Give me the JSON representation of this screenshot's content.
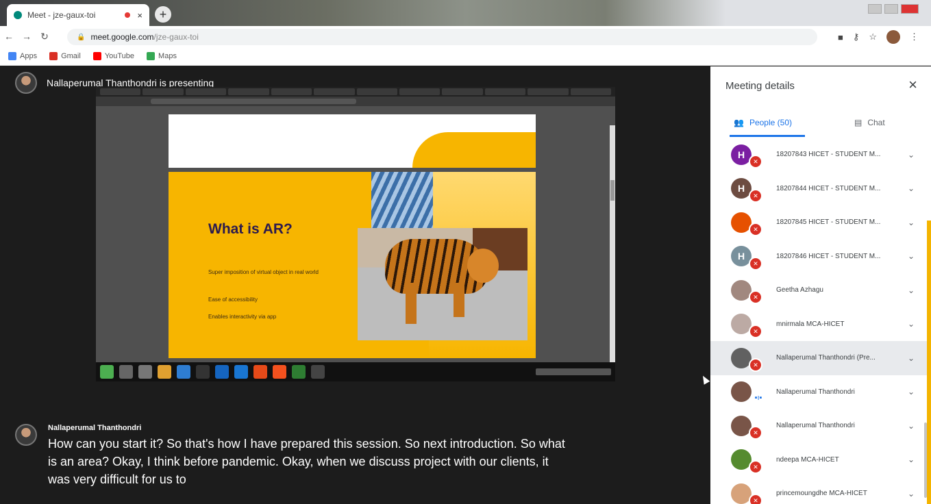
{
  "browser": {
    "tab_title": "Meet - jze-gaux-toi",
    "tab_close": "×",
    "new_tab": "+",
    "url_host": "meet.google.com",
    "url_path": "/jze-gaux-toi",
    "bookmarks": [
      {
        "label": "Apps",
        "color": "#4285f4"
      },
      {
        "label": "Gmail",
        "color": "#d93025"
      },
      {
        "label": "YouTube",
        "color": "#ff0000"
      },
      {
        "label": "Maps",
        "color": "#34a853"
      }
    ]
  },
  "stage": {
    "presenting_text": "Nallaperumal Thanthondri is presenting",
    "slide": {
      "title": "What is AR?",
      "bullets": [
        "Super imposition of virtual object in real world",
        "Ease of accessibility",
        "Enables interactivity via app"
      ]
    },
    "caption": {
      "speaker": "Nallaperumal Thanthondri",
      "text": "How can you start it? So that's how I have prepared this session. So next introduction. So what is an area? Okay, I think before pandemic. Okay, when we discuss project with our clients, it was very difficult for us to"
    }
  },
  "panel": {
    "title": "Meeting details",
    "close": "×",
    "tab_people": "People (50)",
    "tab_chat": "Chat",
    "participants": [
      {
        "name": "18207843 HICET - STUDENT M...",
        "initial": "H",
        "color": "#7b1fa2"
      },
      {
        "name": "18207844 HICET - STUDENT M...",
        "initial": "H",
        "color": "#6d4c41"
      },
      {
        "name": "18207845 HICET - STUDENT M...",
        "initial": "",
        "color": "#e65100"
      },
      {
        "name": "18207846 HICET - STUDENT M...",
        "initial": "H",
        "color": "#78909c"
      },
      {
        "name": "Geetha Azhagu",
        "initial": "",
        "color": "#a1887f"
      },
      {
        "name": "mnirmala MCA-HICET",
        "initial": "",
        "color": "#bcaaa4"
      },
      {
        "name": "Nallaperumal Thanthondri (Pre...",
        "initial": "",
        "color": "#616161"
      },
      {
        "name": "Nallaperumal Thanthondri",
        "initial": "",
        "color": "#795548"
      },
      {
        "name": "Nallaperumal Thanthondri",
        "initial": "",
        "color": "#795548"
      },
      {
        "name": "ndeepa MCA-HICET",
        "initial": "",
        "color": "#558b2f"
      },
      {
        "name": "princemoungdhe MCA-HICET",
        "initial": "",
        "color": "#d7a27a"
      }
    ]
  }
}
